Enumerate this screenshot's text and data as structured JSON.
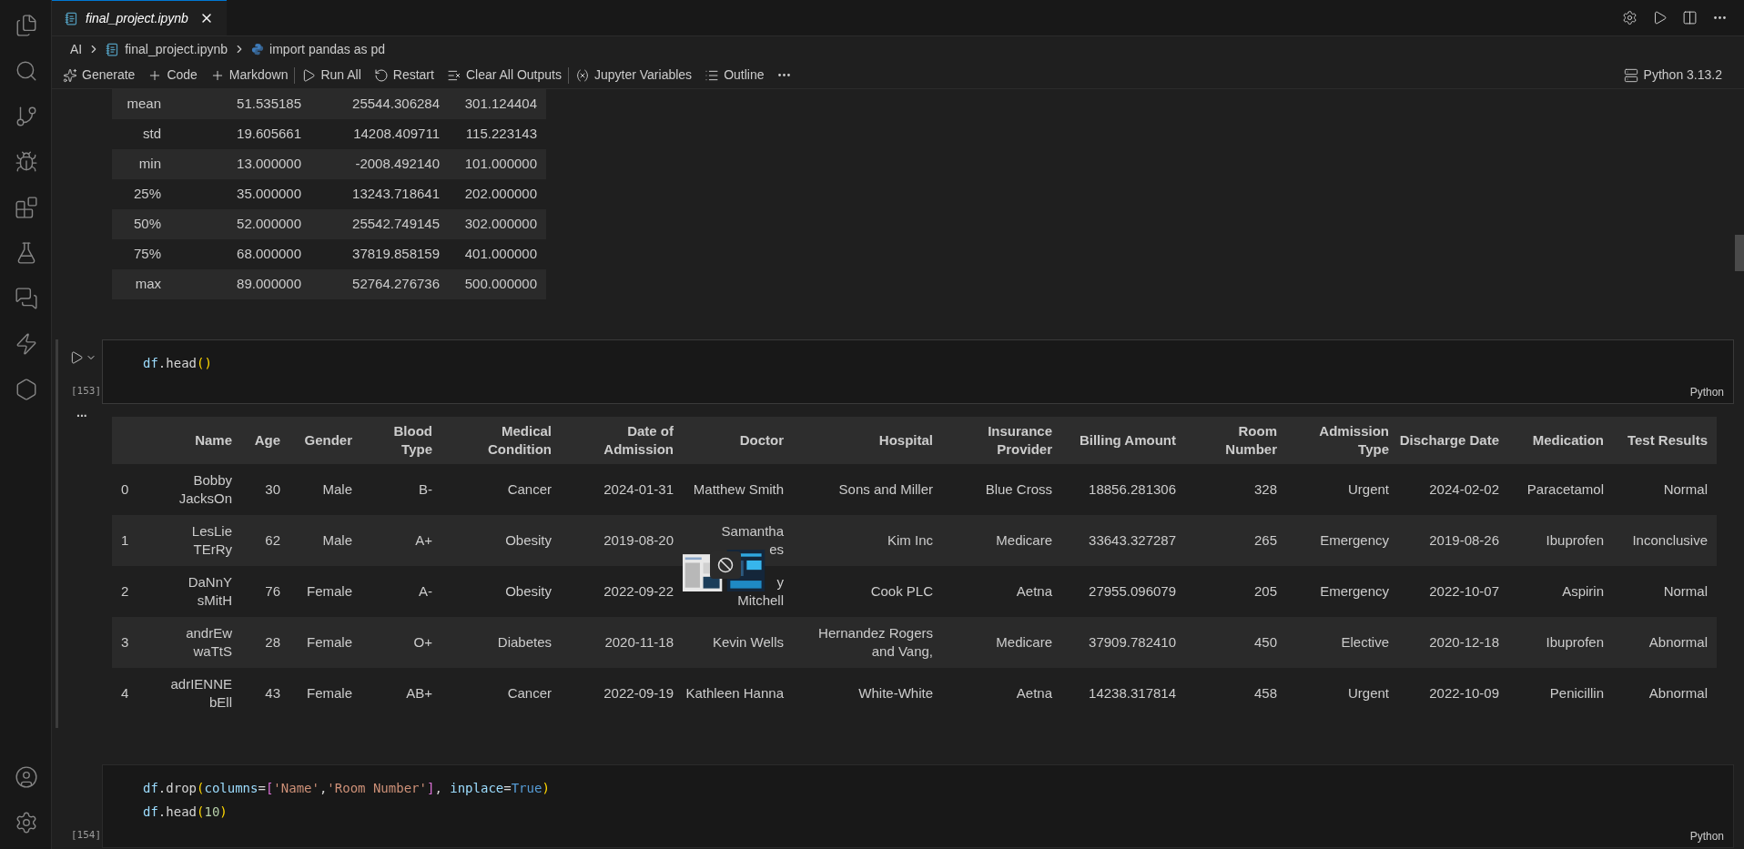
{
  "tab": {
    "title": "final_project.ipynb",
    "selected": true
  },
  "breadcrumbs": [
    {
      "label": "AI",
      "kind": "folder"
    },
    {
      "label": "final_project.ipynb",
      "kind": "notebook"
    },
    {
      "label": "import pandas as pd",
      "kind": "python"
    }
  ],
  "toolbar": [
    [
      {
        "label": "Generate",
        "kind": "sparkle"
      },
      {
        "label": "Code",
        "kind": "plus"
      },
      {
        "label": "Markdown",
        "kind": "plus"
      }
    ],
    [
      {
        "label": "Run All",
        "kind": "run-all"
      },
      {
        "label": "Restart",
        "kind": "restart"
      },
      {
        "label": "Clear All Outputs",
        "kind": "clear"
      }
    ],
    [
      {
        "label": "Jupyter Variables",
        "kind": "variables"
      },
      {
        "label": "Outline",
        "kind": "outline"
      },
      {
        "kind": "more"
      }
    ]
  ],
  "kernel": "Python 3.13.2",
  "describe_rows": [
    [
      "mean",
      "51.535185",
      "25544.306284",
      "301.124404"
    ],
    [
      "std",
      "19.605661",
      "14208.409711",
      "115.223143"
    ],
    [
      "min",
      "13.000000",
      "-2008.492140",
      "101.000000"
    ],
    [
      "25%",
      "35.000000",
      "13243.718641",
      "202.000000"
    ],
    [
      "50%",
      "52.000000",
      "25542.749145",
      "302.000000"
    ],
    [
      "75%",
      "68.000000",
      "37819.858159",
      "401.000000"
    ],
    [
      "max",
      "89.000000",
      "52764.276736",
      "500.000000"
    ]
  ],
  "cells": [
    {
      "execution": "[153]",
      "language": "Python",
      "selected": true,
      "lines": [
        [
          {
            "text": "df",
            "kind": "var"
          },
          {
            "text": ".head",
            "kind": "plain"
          },
          {
            "text": "()",
            "kind": "paren"
          }
        ]
      ]
    },
    {
      "execution": "[154]",
      "language": "Python",
      "selected": false,
      "lines": [
        [
          {
            "text": "df",
            "kind": "var"
          },
          {
            "text": ".drop",
            "kind": "plain"
          },
          {
            "text": "(",
            "kind": "paren"
          },
          {
            "text": "columns",
            "kind": "var"
          },
          {
            "text": "=",
            "kind": "plain"
          },
          {
            "text": "[",
            "kind": "bracket"
          },
          {
            "text": "'Name'",
            "kind": "string"
          },
          {
            "text": ",",
            "kind": "plain"
          },
          {
            "text": "'Room Number'",
            "kind": "string"
          },
          {
            "text": "]",
            "kind": "bracket"
          },
          {
            "text": ", ",
            "kind": "plain"
          },
          {
            "text": "inplace",
            "kind": "var"
          },
          {
            "text": "=",
            "kind": "plain"
          },
          {
            "text": "True",
            "kind": "const"
          },
          {
            "text": ")",
            "kind": "paren"
          }
        ],
        [
          {
            "text": "df",
            "kind": "var"
          },
          {
            "text": ".head",
            "kind": "plain"
          },
          {
            "text": "(",
            "kind": "paren"
          },
          {
            "text": "10",
            "kind": "number"
          },
          {
            "text": ")",
            "kind": "paren"
          }
        ]
      ]
    }
  ],
  "output_menu": "...",
  "table": {
    "columns": [
      "",
      "Name",
      "Age",
      "Gender",
      "Blood Type",
      "Medical Condition",
      "Date of Admission",
      "Doctor",
      "Hospital",
      "Insurance Provider",
      "Billing Amount",
      "Room Number",
      "Admission Type",
      "Discharge Date",
      "Medication",
      "Test Results"
    ],
    "rows": [
      [
        "0",
        "Bobby JacksOn",
        "30",
        "Male",
        "B-",
        "Cancer",
        "2024-01-31",
        "Matthew Smith",
        "Sons and Miller",
        "Blue Cross",
        "18856.281306",
        "328",
        "Urgent",
        "2024-02-02",
        "Paracetamol",
        "Normal"
      ],
      [
        "1",
        "LesLie TErRy",
        "62",
        "Male",
        "A+",
        "Obesity",
        "2019-08-20",
        "Samantha\nes",
        "Kim Inc",
        "Medicare",
        "33643.327287",
        "265",
        "Emergency",
        "2019-08-26",
        "Ibuprofen",
        "Inconclusive"
      ],
      [
        "2",
        "DaNnY sMitH",
        "76",
        "Female",
        "A-",
        "Obesity",
        "2022-09-22",
        "y\nMitchell",
        "Cook PLC",
        "Aetna",
        "27955.096079",
        "205",
        "Emergency",
        "2022-10-07",
        "Aspirin",
        "Normal"
      ],
      [
        "3",
        "andrEw waTtS",
        "28",
        "Female",
        "O+",
        "Diabetes",
        "2020-11-18",
        "Kevin Wells",
        "Hernandez Rogers and Vang,",
        "Medicare",
        "37909.782410",
        "450",
        "Elective",
        "2020-12-18",
        "Ibuprofen",
        "Abnormal"
      ],
      [
        "4",
        "adrIENNE bEll",
        "43",
        "Female",
        "AB+",
        "Cancer",
        "2022-09-19",
        "Kathleen Hanna",
        "White-White",
        "Aetna",
        "14238.317814",
        "458",
        "Urgent",
        "2022-10-09",
        "Penicillin",
        "Abnormal"
      ]
    ]
  }
}
